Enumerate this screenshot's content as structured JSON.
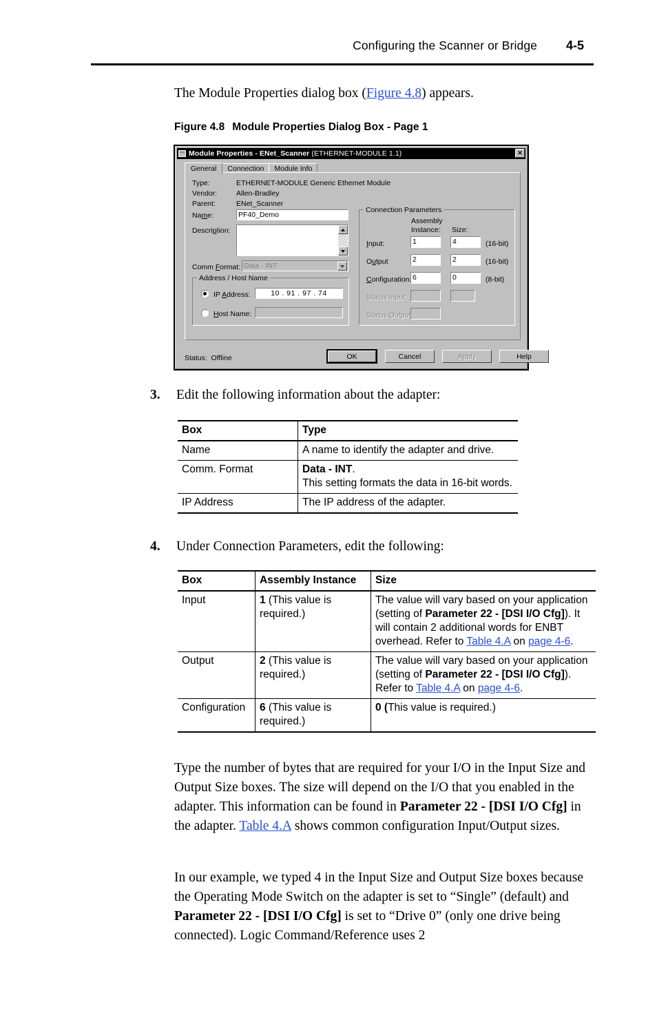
{
  "header": {
    "title": "Configuring the Scanner or Bridge",
    "page_number": "4-5"
  },
  "intro": {
    "before": "The Module Properties dialog box (",
    "link": "Figure 4.8",
    "after": ") appears."
  },
  "figure_caption": {
    "label": "Figure 4.8",
    "title": "Module Properties Dialog Box - Page 1"
  },
  "dialog": {
    "title_bold": "Module Properties - ENet_Scanner ",
    "title_light": "(ETHERNET-MODULE 1.1)",
    "close_glyph": "✕",
    "tabs": [
      {
        "label": "General",
        "active": true
      },
      {
        "label": "Connection",
        "active": false
      },
      {
        "label": "Module Info",
        "active": false
      }
    ],
    "fields": {
      "type_label": "Type:",
      "type_value": "ETHERNET-MODULE Generic Ethernet Module",
      "vendor_label": "Vendor:",
      "vendor_value": "Allen-Bradley",
      "parent_label": "Parent:",
      "parent_value": "ENet_Scanner",
      "name_label": "Name:",
      "name_value": "PF40_Demo",
      "description_label": "Description:",
      "description_value": "",
      "comm_format_label": "Comm Format:",
      "comm_format_value": "Data - INT"
    },
    "address_group": {
      "title": "Address / Host Name",
      "ip_label": "IP Address:",
      "ip_value": "10  .  91  .  97  .  74",
      "ip_selected": true,
      "host_label": "Host Name:",
      "host_value": ""
    },
    "connection_params": {
      "title": "Connection Parameters",
      "col_assembly": "Assembly\nInstance:",
      "col_assembly_line1": "Assembly",
      "col_assembly_line2": "Instance:",
      "col_size": "Size:",
      "rows": [
        {
          "label": "Input:",
          "instance": "1",
          "size": "4",
          "unit": "(16-bit)",
          "disabled": false,
          "has_size": true
        },
        {
          "label": "Output",
          "instance": "2",
          "size": "2",
          "unit": "(16-bit)",
          "disabled": false,
          "has_size": true
        },
        {
          "label": "Configuration:",
          "instance": "6",
          "size": "0",
          "unit": "(8-bit)",
          "disabled": false,
          "has_size": true
        },
        {
          "label": "Status Input:",
          "instance": "",
          "size": "",
          "unit": "",
          "disabled": true,
          "has_size": true
        },
        {
          "label": "Status Output:",
          "instance": "",
          "size": "",
          "unit": "",
          "disabled": true,
          "has_size": false
        }
      ]
    },
    "status_label": "Status:",
    "status_value": "Offline",
    "buttons": [
      {
        "label": "OK",
        "default": true,
        "disabled": false
      },
      {
        "label": "Cancel",
        "default": false,
        "disabled": false
      },
      {
        "label": "Apply",
        "default": false,
        "disabled": true
      },
      {
        "label": "Help",
        "default": false,
        "disabled": false
      }
    ]
  },
  "step3": {
    "number": "3.",
    "text": "Edit the following information about the adapter:"
  },
  "table1": {
    "headers": [
      "Box",
      "Type"
    ],
    "rows": [
      {
        "box": "Name",
        "type_plain": "A name to identify the adapter and drive.",
        "type_bold": "",
        "type_line2": ""
      },
      {
        "box": "Comm. Format",
        "type_bold": "Data - INT",
        "type_plain": ".",
        "type_line2": "This setting formats the data in 16-bit words."
      },
      {
        "box": "IP Address",
        "type_plain": "The IP address of the adapter.",
        "type_bold": "",
        "type_line2": ""
      }
    ]
  },
  "step4": {
    "number": "4.",
    "text": "Under Connection Parameters, edit the following:"
  },
  "table2": {
    "headers": [
      "Box",
      "Assembly Instance",
      "Size"
    ],
    "rows": [
      {
        "box": "Input",
        "instance_bold": "1",
        "instance_rest": " (This value is required.)",
        "size_a": "The value will vary based on your application (setting of ",
        "size_bold1": "Parameter 22 - [DSI I/O Cfg]",
        "size_b": "). It will contain 2 additional words for ENBT overhead. Refer to ",
        "size_link1": "Table 4.A",
        "size_c": " on ",
        "size_link2": "page 4-6",
        "size_d": "."
      },
      {
        "box": "Output",
        "instance_bold": "2",
        "instance_rest": " (This value is required.)",
        "size_a": "The value will vary based on your application (setting of ",
        "size_bold1": "Parameter 22 - [DSI I/O Cfg]",
        "size_b": "). Refer to ",
        "size_link1": "Table 4.A",
        "size_c": " on ",
        "size_link2": "page 4-6",
        "size_d": "."
      },
      {
        "box": "Configuration",
        "instance_bold": "6",
        "instance_rest": " (This value is required.)",
        "size_bold0": "0 (",
        "size_a": "This value is required.)",
        "size_bold1": "",
        "size_b": "",
        "size_link1": "",
        "size_c": "",
        "size_link2": "",
        "size_d": ""
      }
    ]
  },
  "para1": {
    "a": "Type the number of bytes that are required for your I/O in the Input Size and Output Size boxes. The size will depend on the I/O that you enabled in the adapter. This information can be found in ",
    "bold1": "Parameter 22 - [DSI I/O Cfg]",
    "b": " in the adapter. ",
    "link1": "Table 4.A",
    "c": " shows common configuration Input/Output sizes."
  },
  "para2": {
    "a": "In our example, we typed 4 in the Input Size and Output Size boxes because the Operating Mode Switch on the adapter is set to “Single” (default) and ",
    "bold1": "Parameter 22 - [DSI I/O Cfg]",
    "b": " is set to “Drive 0” (only one drive being connected). Logic Command/Reference uses 2"
  },
  "colors": {
    "link": "#2b50d8",
    "dialog_face": "#c0c0c0",
    "titlebar": "#000000",
    "text": "#000000"
  }
}
